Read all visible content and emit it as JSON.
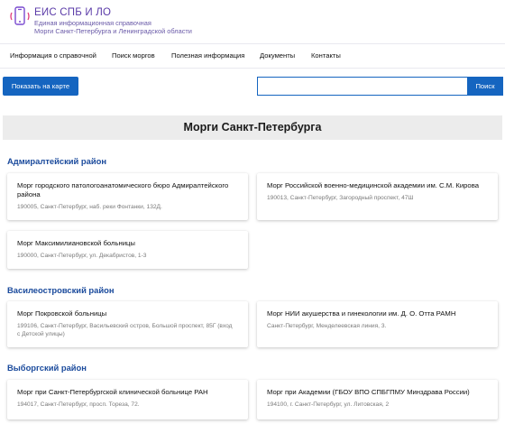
{
  "header": {
    "brand_name": "ЕИС СПБ И ЛО",
    "subtitle_line1": "Единая информационная справочная",
    "subtitle_line2": "Морги Санкт-Петербурга и Ленинградской области",
    "logo_icon": "phone-info-icon"
  },
  "nav": {
    "items": [
      "Информация о справочной",
      "Поиск моргов",
      "Полезная информация",
      "Документы",
      "Контакты"
    ]
  },
  "toolbar": {
    "map_button": "Показать на карте",
    "search_value": "",
    "search_button": "Поиск"
  },
  "page": {
    "title": "Морги Санкт-Петербурга"
  },
  "colors": {
    "accent": "#1565c0",
    "district_heading": "#1a4a9c",
    "brand": "#5a3aa8"
  },
  "districts": [
    {
      "name": "Адмиралтейский район",
      "morgues": [
        {
          "title": "Морг городского патологоанатомического бюро Адмиралтейского района",
          "address": "190005, Санкт-Петербург, наб. реки Фонтанки, 132Д."
        },
        {
          "title": "Морг Российской военно-медицинской академии им. С.М. Кирова",
          "address": "190013, Санкт-Петербург, Загородный проспект, 47Ш"
        },
        {
          "title": "Морг Максимилиановской больницы",
          "address": "190000, Санкт-Петербург, ул. Декабристов, 1-3"
        }
      ]
    },
    {
      "name": "Василеостровский район",
      "morgues": [
        {
          "title": "Морг Покровской больницы",
          "address_line1": "199106, Санкт-Петербург, Васильевский остров, Большой проспект, 85Г (вход",
          "address_line2": "с Детской улицы)"
        },
        {
          "title": "Морг НИИ акушерства и гинекологии им. Д. О. Отта РАМН",
          "address": "Санкт-Петербург, Менделеевская линия, 3."
        }
      ]
    },
    {
      "name": "Выборгский район",
      "morgues": [
        {
          "title": "Морг при Санкт-Петербургской клинической больнице РАН",
          "address": "194017, Санкт-Петербург, просп. Тореза, 72."
        },
        {
          "title": "Морг при Академии (ГБОУ ВПО СПБГПМУ Минздрава России)",
          "address": "194100, г. Санкт-Петербург, ул. Литовская, 2"
        }
      ]
    }
  ]
}
